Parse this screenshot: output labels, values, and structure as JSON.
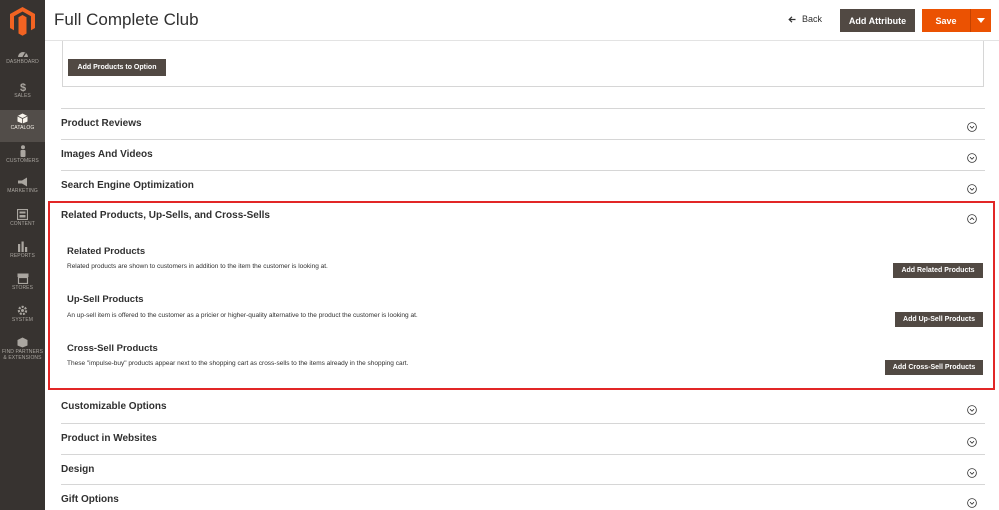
{
  "header": {
    "title": "Full Complete Club",
    "back_label": "Back",
    "add_attribute_label": "Add Attribute",
    "save_label": "Save"
  },
  "sidebar": {
    "items": [
      {
        "label": "DASHBOARD",
        "icon": "dashboard-icon"
      },
      {
        "label": "SALES",
        "icon": "dollar-icon"
      },
      {
        "label": "CATALOG",
        "icon": "cube-icon"
      },
      {
        "label": "CUSTOMERS",
        "icon": "person-icon"
      },
      {
        "label": "MARKETING",
        "icon": "megaphone-icon"
      },
      {
        "label": "CONTENT",
        "icon": "content-icon"
      },
      {
        "label": "REPORTS",
        "icon": "bar-chart-icon"
      },
      {
        "label": "STORES",
        "icon": "storefront-icon"
      },
      {
        "label": "SYSTEM",
        "icon": "gear-icon"
      },
      {
        "label": "FIND PARTNERS",
        "label2": "& EXTENSIONS",
        "icon": "box-icon"
      }
    ],
    "active_index": 2
  },
  "option_box": {
    "button_label": "Add Products to Option"
  },
  "sections": [
    {
      "title": "Product Reviews"
    },
    {
      "title": "Images And Videos"
    },
    {
      "title": "Search Engine Optimization"
    },
    {
      "title": "Related Products, Up-Sells, and Cross-Sells"
    },
    {
      "title": "Customizable Options"
    },
    {
      "title": "Product in Websites"
    },
    {
      "title": "Design"
    },
    {
      "title": "Gift Options"
    }
  ],
  "related": {
    "related_title": "Related Products",
    "related_desc": "Related products are shown to customers in addition to the item the customer is looking at.",
    "related_button": "Add Related Products",
    "upsell_title": "Up-Sell Products",
    "upsell_desc": "An up-sell item is offered to the customer as a pricier or higher-quality alternative to the product the customer is looking at.",
    "upsell_button": "Add Up-Sell Products",
    "crosssell_title": "Cross-Sell Products",
    "crosssell_desc": "These \"impulse-buy\" products appear next to the shopping cart as cross-sells to the items already in the shopping cart.",
    "crosssell_button": "Add Cross-Sell Products"
  },
  "colors": {
    "sidebar_bg": "#373330",
    "accent_orange": "#eb5202",
    "dark_button": "#514943",
    "highlight_red": "#e22626"
  }
}
